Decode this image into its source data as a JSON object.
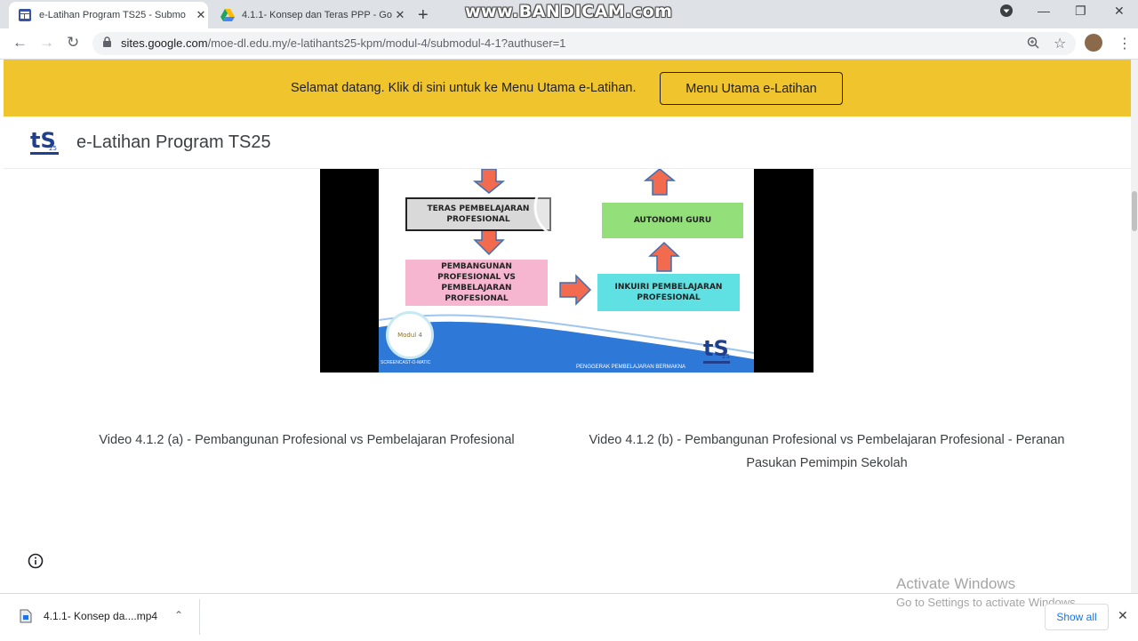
{
  "browser": {
    "tabs": [
      {
        "title": "e-Latihan Program TS25 - Submo",
        "active": true,
        "icon": "google-sites-icon"
      },
      {
        "title": "4.1.1- Konsep dan Teras PPP - Go",
        "active": false,
        "icon": "google-drive-icon"
      }
    ],
    "new_tab": "+",
    "watermark": "www.BANDICAM.com",
    "url_host": "sites.google.com",
    "url_path": "/moe-dl.edu.my/e-latihants25-kpm/modul-4/submodul-4-1?authuser=1"
  },
  "banner": {
    "text": "Selamat datang. Klik di sini untuk ke Menu Utama e-Latihan.",
    "button_label": "Menu Utama e-Latihan",
    "color": "#f0c42d"
  },
  "site": {
    "title": "e-Latihan Program TS25",
    "logo_text": "tS"
  },
  "video": {
    "boxes": {
      "teras": "TERAS PEMBELAJARAN PROFESIONAL",
      "autonomi": "AUTONOMI GURU",
      "pembangunan": "PEMBANGUNAN PROFESIONAL VS PEMBELAJARAN PROFESIONAL",
      "inkuiri": "INKUIRI PEMBELAJARAN PROFESIONAL"
    },
    "badge": "Modul 4",
    "footer": "PENGGERAK PEMBELAJARAN BERMAKNA",
    "screencast": "SCREENCAST-O-MATIC"
  },
  "captions": {
    "left": "Video 4.1.2 (a) - Pembangunan Profesional vs Pembelajaran Profesional",
    "right": "Video 4.1.2 (b) - Pembangunan Profesional vs Pembelajaran Profesional - Peranan Pasukan Pemimpin Sekolah"
  },
  "download": {
    "filename": "4.1.1- Konsep da....mp4",
    "show_all": "Show all"
  },
  "os_overlay": {
    "line1": "Activate Windows",
    "line2": "Go to Settings to activate Windows."
  }
}
